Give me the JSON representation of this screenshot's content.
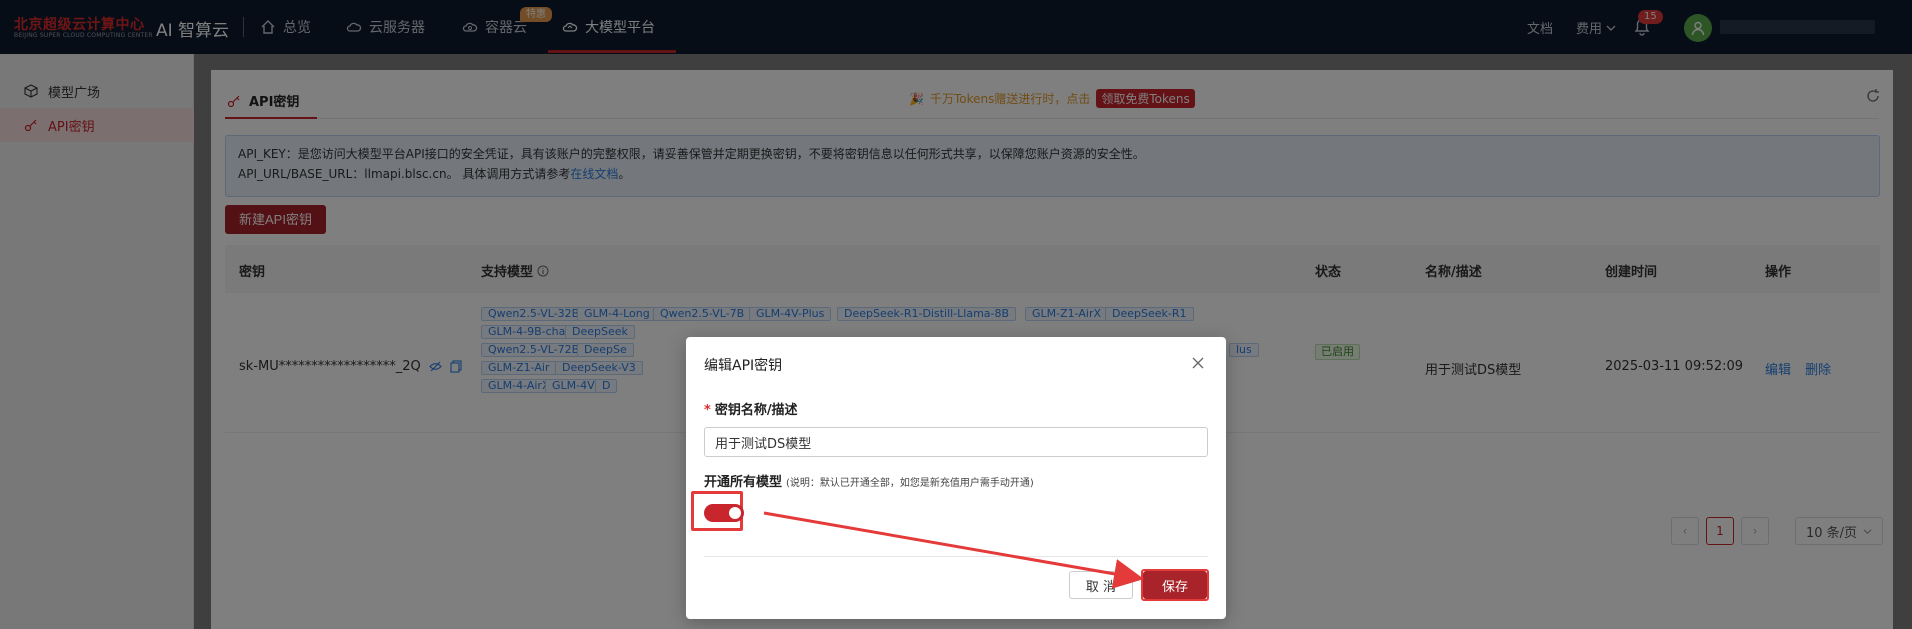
{
  "header": {
    "logo_cn": "北京超级云计算中心",
    "logo_en": "BEIJING SUPER CLOUD COMPUTING CENTER",
    "brand": "AI 智算云",
    "nav": [
      {
        "label": "总览"
      },
      {
        "label": "云服务器"
      },
      {
        "label": "容器云"
      },
      {
        "label": "大模型平台"
      }
    ],
    "hot_badge": "特惠",
    "docs": "文档",
    "fees": "费用",
    "notify_count": "15"
  },
  "sidebar": {
    "items": [
      {
        "label": "模型广场"
      },
      {
        "label": "API密钥"
      }
    ]
  },
  "page": {
    "tab": "API密钥",
    "promo_text": "千万Tokens赠送进行时，点击",
    "promo_button": "领取免费Tokens",
    "info_line1": "API_KEY：是您访问大模型平台API接口的安全凭证，具有该账户的完整权限，请妥善保管并定期更换密钥，不要将密钥信息以任何形式共享，以保障您账户资源的安全性。",
    "info_line2_prefix": "API_URL/BASE_URL：llmapi.blsc.cn。 具体调用方式请参考",
    "info_link": "在线文档",
    "info_line2_suffix": "。",
    "new_button": "新建API密钥",
    "columns": [
      "密钥",
      "支持模型",
      "状态",
      "名称/描述",
      "创建时间",
      "操作"
    ],
    "row": {
      "key": "sk-MU******************_2Q",
      "tags_row1": [
        "Qwen2.5-VL-32B",
        "GLM-4-Long",
        "Qwen2.5-VL-7B",
        "GLM-4V-Plus",
        "DeepSeek-R1-Distill-Llama-8B",
        "GLM-Z1-AirX",
        "DeepSeek-R1"
      ],
      "tags_row2": [
        "GLM-4-9B-chat",
        "DeepSeek"
      ],
      "tags_row3": [
        "Qwen2.5-VL-72B",
        "DeepSe"
      ],
      "tags_row3_tail": "lus",
      "tags_row4": [
        "GLM-Z1-Air",
        "DeepSeek-V3"
      ],
      "tags_row5": [
        "GLM-4-AirX",
        "GLM-4V",
        "D"
      ],
      "status": "已启用",
      "name": "用于测试DS模型",
      "created": "2025-03-11 09:52:09",
      "edit": "编辑",
      "delete": "删除"
    },
    "pagination": {
      "current": "1",
      "page_size": "10 条/页"
    }
  },
  "modal": {
    "title": "编辑API密钥",
    "field_label": "密钥名称/描述",
    "required_mark": "*",
    "field_value": "用于测试DS模型",
    "toggle_label": "开通所有模型",
    "toggle_note": "(说明：默认已开通全部，如您是新充值用户需手动开通)",
    "toggle_on": true,
    "cancel": "取 消",
    "save": "保存"
  },
  "colors": {
    "brand_red": "#c8252c",
    "nav_bg": "#0c1a2e",
    "link_blue": "#2b7de0",
    "annotation_red": "#e53a3a"
  }
}
